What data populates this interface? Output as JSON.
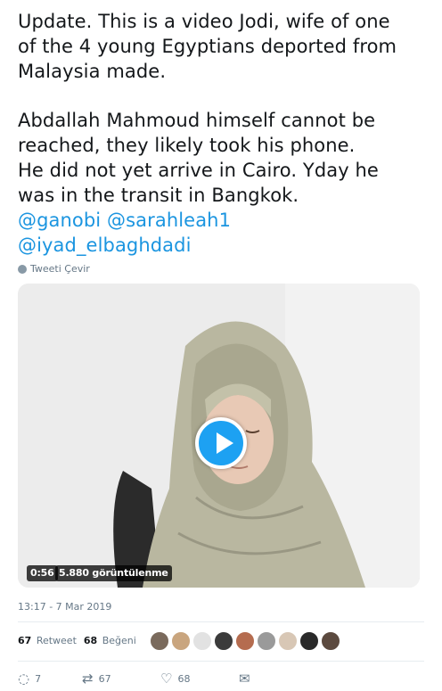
{
  "tweet": {
    "lines_p1": [
      "Update. This is a video Jodi, wife of one",
      "of the 4 young Egyptians deported from",
      "Malaysia made."
    ],
    "lines_p2": [
      "Abdallah Mahmoud himself cannot be",
      "reached, they likely took his phone.",
      "He did not yet arrive in Cairo. Yday he",
      "was in the transit in Bangkok."
    ],
    "mention1": "@ganobi",
    "mention2": "@sarahleah1",
    "mention3": "@iyad_elbaghdadi"
  },
  "translate_label": "Tweeti Çevir",
  "video": {
    "duration": "0:56",
    "views": "5.880 görüntülenme"
  },
  "timestamp": "13:17 - 7 Mar 2019",
  "stats": {
    "retweet_count": "67",
    "retweet_label": "Retweet",
    "like_count": "68",
    "like_label": "Beğeni"
  },
  "avatar_colors": [
    "#7a6a5c",
    "#c9a57e",
    "#e2e2e2",
    "#3b3b3b",
    "#b56c4f",
    "#9a9a9a",
    "#d8c7b5",
    "#2a2a2a",
    "#5c4a3f"
  ],
  "actions": {
    "reply_count": "7",
    "retweet_count": "67",
    "like_count": "68"
  },
  "colors": {
    "link": "#1b95e0",
    "accent": "#1da1f2",
    "muted": "#657786"
  }
}
